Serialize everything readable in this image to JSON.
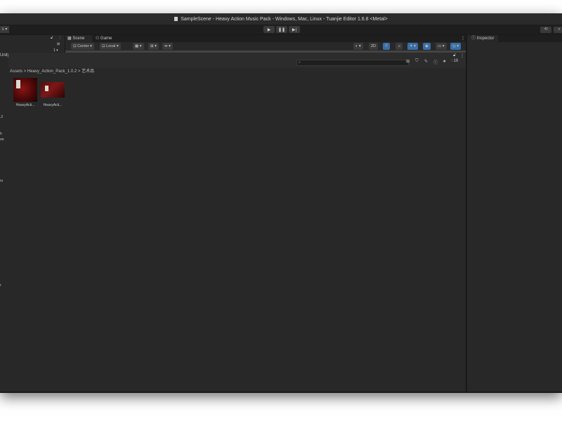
{
  "window": {
    "title": "SampleScene - Heavy Action Music Pack - Windows, Mac, Linux - Tuanjie Editor 1.6.8 <Metal>"
  },
  "toolbar": {
    "left_fragment": "s ▾",
    "play": "▶",
    "pause": "❚❚",
    "step": "▶|",
    "history_icon": "history-icon",
    "search_icon": "search-icon"
  },
  "left_panel": {
    "lock_icon": "lock-icon",
    "menu": "⋮",
    "unity_version_control": "Unity Version Control",
    "fragments": [
      "1 ▾",
      ".2",
      "h",
      "on",
      "rs",
      "r"
    ]
  },
  "scene_tabs": {
    "scene": "Scene",
    "game": "Game"
  },
  "scene_toolbar": {
    "center": "Center",
    "local": "Local",
    "mode_2d": "2D"
  },
  "inspector": {
    "label": "Inspector"
  },
  "project": {
    "hidden_count": "16",
    "breadcrumb": [
      "Assets",
      "Heavy_Action_Pack_1.0.2",
      "艺术品"
    ],
    "assets": [
      {
        "label": "HeavyActi..."
      },
      {
        "label": "HeavyActi..."
      }
    ]
  },
  "colors": {
    "window_bg": "#191919",
    "panel_bg": "#282828",
    "accent_blue": "#3a6ea5"
  }
}
